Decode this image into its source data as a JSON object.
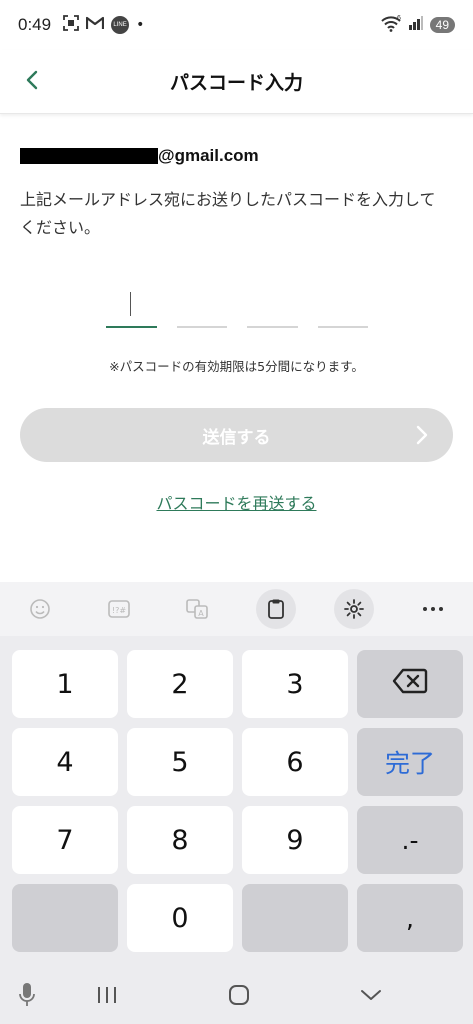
{
  "status": {
    "time": "0:49",
    "line_label": "LINE",
    "wifi_badge": "6",
    "battery": "49"
  },
  "header": {
    "title": "パスコード入力"
  },
  "content": {
    "email_domain": "@gmail.com",
    "instruction": "上記メールアドレス宛にお送りしたパスコードを入力してください。",
    "note": "※パスコードの有効期限は5分間になります。",
    "submit_label": "送信する",
    "resend_link": "パスコードを再送する"
  },
  "keyboard": {
    "toolbar_icons": [
      "emoji-icon",
      "symbols-icon",
      "translate-icon",
      "clipboard-icon",
      "settings-icon",
      "more-icon"
    ],
    "keys": {
      "k1": "1",
      "k2": "2",
      "k3": "3",
      "k4": "4",
      "k5": "5",
      "k6": "6",
      "k7": "7",
      "k8": "8",
      "k9": "9",
      "k0": "0",
      "done": "完了",
      "dot_dash": ".-",
      "comma": ","
    }
  },
  "colors": {
    "accent": "#2e7a5a",
    "disabled_button": "#dcdcdc",
    "done_key": "#2d6bd6"
  }
}
